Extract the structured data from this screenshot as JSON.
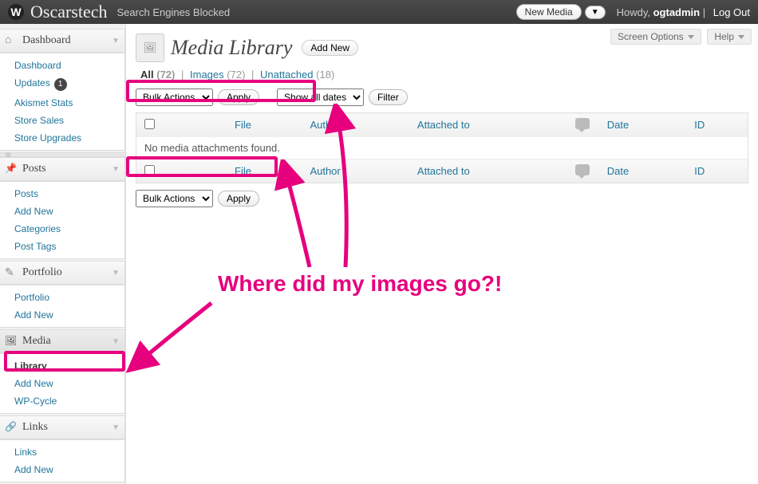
{
  "adminbar": {
    "site_title": "Oscarstech",
    "seb": "Search Engines Blocked",
    "new_btn": "New Media",
    "howdy": "Howdy,",
    "user": "ogtadmin",
    "logout": "Log Out"
  },
  "toptabs": {
    "screen_options": "Screen Options",
    "help": "Help"
  },
  "sidebar": {
    "dashboard": {
      "head": "Dashboard",
      "items": [
        "Dashboard",
        "Updates",
        "Akismet Stats",
        "Store Sales",
        "Store Upgrades"
      ],
      "updates_badge": "1"
    },
    "posts": {
      "head": "Posts",
      "items": [
        "Posts",
        "Add New",
        "Categories",
        "Post Tags"
      ]
    },
    "portfolio": {
      "head": "Portfolio",
      "items": [
        "Portfolio",
        "Add New"
      ]
    },
    "media": {
      "head": "Media",
      "items": [
        "Library",
        "Add New",
        "WP-Cycle"
      ]
    },
    "links": {
      "head": "Links",
      "items": [
        "Links",
        "Add New"
      ]
    }
  },
  "page": {
    "title": "Media Library",
    "add_new": "Add New"
  },
  "filters": {
    "all_label": "All",
    "all_count": "(72)",
    "images_label": "Images",
    "images_count": "(72)",
    "unattached_label": "Unattached",
    "unattached_count": "(18)"
  },
  "tablenav": {
    "bulk_actions": "Bulk Actions",
    "apply": "Apply",
    "show_all_dates": "Show all dates",
    "filter": "Filter"
  },
  "columns": {
    "file": "File",
    "author": "Author",
    "attached": "Attached to",
    "date": "Date",
    "id": "ID"
  },
  "no_items": "No media attachments found.",
  "annotation": "Where did my images go?!"
}
